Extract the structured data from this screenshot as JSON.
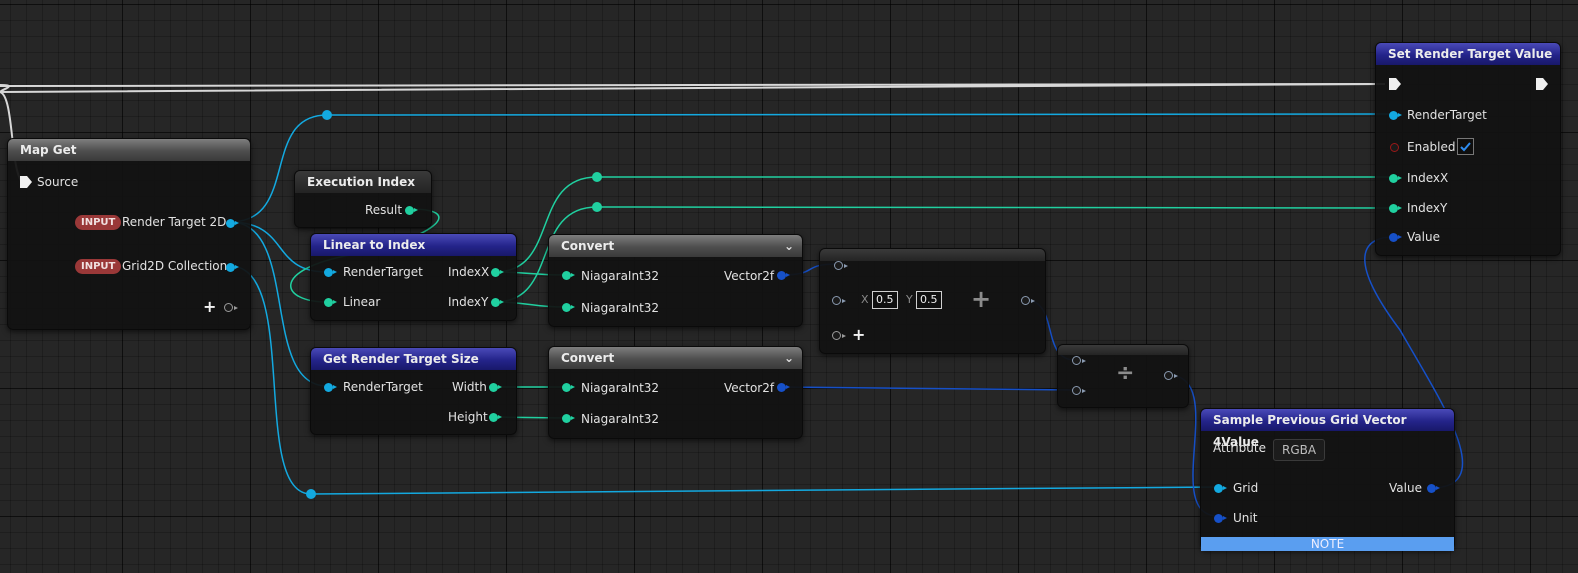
{
  "colors": {
    "float_pin": "#13a9e0",
    "int_pin": "#20d0a0",
    "vector2_pin": "#1650c8",
    "bool_pin": "#9a1818",
    "function_header": "#24248a",
    "input_badge": "#9a3838",
    "note_bar": "#5a9ef0"
  },
  "map_get": {
    "title": "Map Get",
    "source_label": "Source",
    "outputs": [
      {
        "badge": "INPUT",
        "label": "Render Target 2D"
      },
      {
        "badge": "INPUT",
        "label": "Grid2D Collection"
      }
    ],
    "add_icon": "plus-icon"
  },
  "execution_index": {
    "title": "Execution Index",
    "result_label": "Result"
  },
  "linear_to_index": {
    "title": "Linear to Index",
    "inputs": [
      "RenderTarget",
      "Linear"
    ],
    "outputs": [
      "IndexX",
      "IndexY"
    ]
  },
  "get_render_target_size": {
    "title": "Get Render Target Size",
    "inputs": [
      "RenderTarget"
    ],
    "outputs": [
      "Width",
      "Height"
    ]
  },
  "convert_1": {
    "title": "Convert",
    "inputs": [
      "NiagaraInt32",
      "NiagaraInt32"
    ],
    "output": "Vector2f"
  },
  "convert_2": {
    "title": "Convert",
    "inputs": [
      "NiagaraInt32",
      "NiagaraInt32"
    ],
    "output": "Vector2f"
  },
  "add_node": {
    "x_label": "X",
    "x_value": "0.5",
    "y_label": "Y",
    "y_value": "0.5",
    "op": "+",
    "add_icon": "plus-icon"
  },
  "divide_node": {
    "op": "÷"
  },
  "sample_grid": {
    "title": "Sample Previous Grid Vector 4Value",
    "attribute_label": "Attribute",
    "attribute_value": "RGBA",
    "inputs": [
      "Grid",
      "Unit"
    ],
    "output": "Value",
    "note": "NOTE"
  },
  "set_render_target": {
    "title": "Set Render Target Value",
    "inputs": [
      "RenderTarget",
      "Enabled",
      "IndexX",
      "IndexY",
      "Value"
    ],
    "enabled_checked": true
  }
}
